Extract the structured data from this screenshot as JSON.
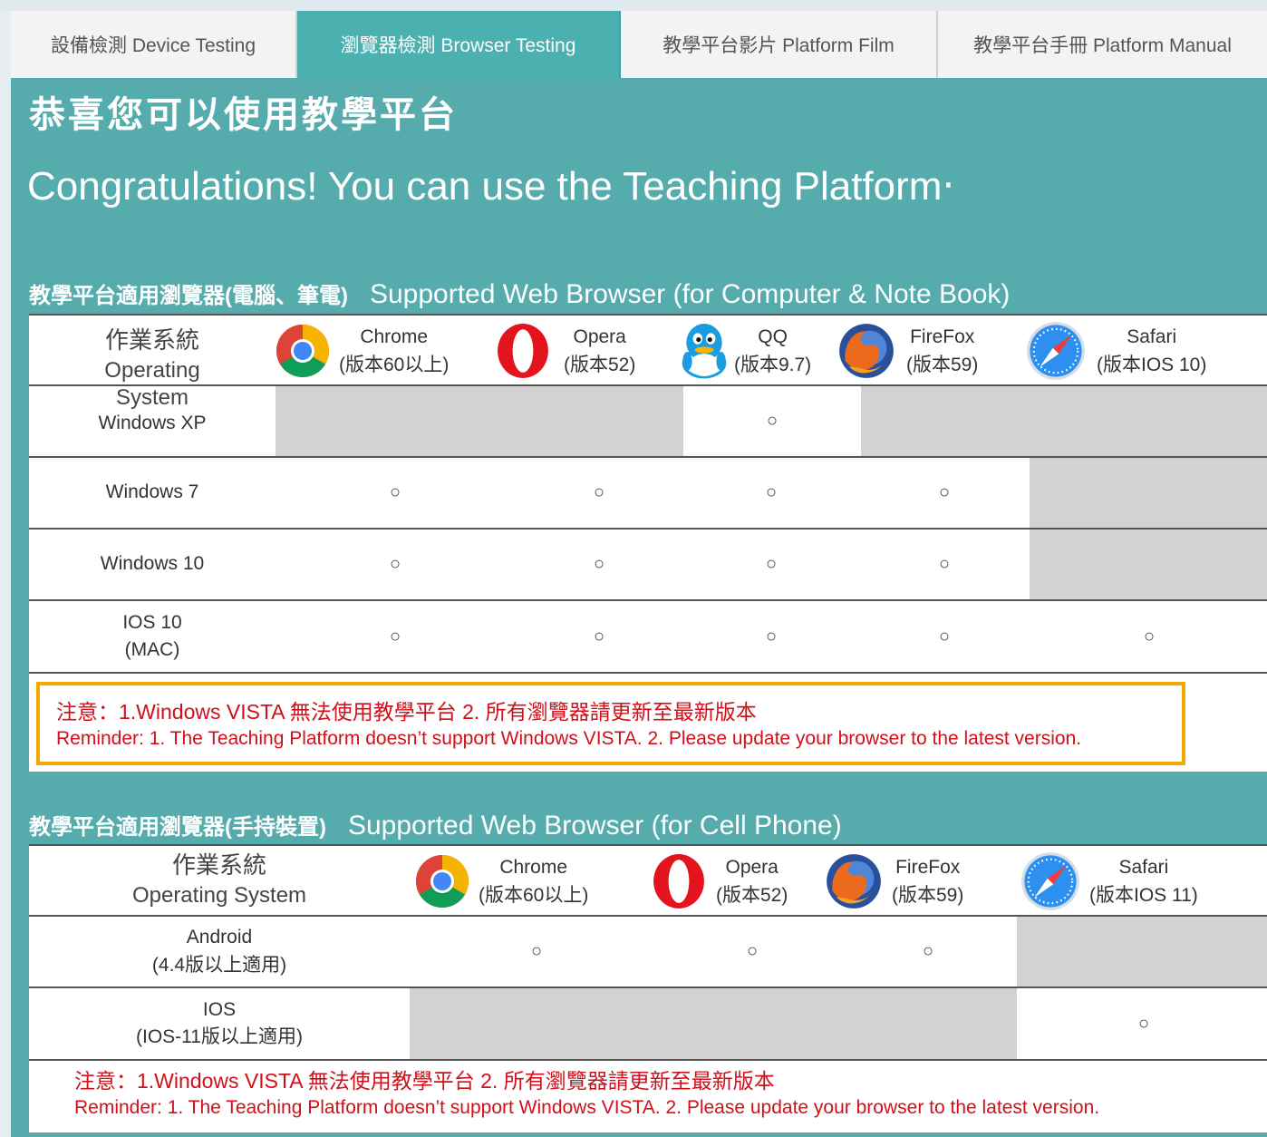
{
  "tabs": [
    {
      "label": "設備檢測 Device Testing",
      "active": false
    },
    {
      "label": "瀏覽器檢測 Browser Testing",
      "active": true
    },
    {
      "label": "教學平台影片 Platform Film",
      "active": false
    },
    {
      "label": "教學平台手冊 Platform Manual",
      "active": false
    }
  ],
  "header": {
    "title_zh": "恭喜您可以使用教學平台",
    "title_en": "Congratulations!  You can use the Teaching Platform‧"
  },
  "computer": {
    "label_zh": "教學平台適用瀏覽器(電腦、筆電)",
    "label_en": "Supported Web Browser (for Computer & Note Book)",
    "os_header_zh": "作業系統",
    "os_header_en": "Operating System",
    "browsers": [
      {
        "name": "Chrome",
        "version": "(版本60以上)",
        "icon": "chrome-icon"
      },
      {
        "name": "Opera",
        "version": "(版本52)",
        "icon": "opera-icon"
      },
      {
        "name": "QQ",
        "version": "(版本9.7)",
        "icon": "qq-icon"
      },
      {
        "name": "FireFox",
        "version": "(版本59)",
        "icon": "firefox-icon"
      },
      {
        "name": "Safari",
        "version": "(版本IOS 10)",
        "icon": "safari-icon"
      }
    ],
    "rows": [
      {
        "os": "Windows XP",
        "os2": "",
        "support": [
          false,
          false,
          true,
          false,
          false
        ]
      },
      {
        "os": "Windows 7",
        "os2": "",
        "support": [
          true,
          true,
          true,
          true,
          false
        ]
      },
      {
        "os": "Windows 10",
        "os2": "",
        "support": [
          true,
          true,
          true,
          true,
          false
        ]
      },
      {
        "os": "IOS 10",
        "os2": "(MAC)",
        "support": [
          true,
          true,
          true,
          true,
          true
        ]
      }
    ],
    "mark": "○",
    "notice_zh": "注意：1.Windows VISTA 無法使用教學平台  2. 所有瀏覽器請更新至最新版本",
    "notice_en": "Reminder: 1. The Teaching Platform doesn’t support Windows VISTA.  2. Please update your browser to the latest version."
  },
  "phone": {
    "label_zh": "教學平台適用瀏覽器(手持裝置)",
    "label_en": "Supported Web Browser (for Cell Phone)",
    "os_header_zh": "作業系統",
    "os_header_en": "Operating System",
    "browsers": [
      {
        "name": "Chrome",
        "version": "(版本60以上)",
        "icon": "chrome-icon"
      },
      {
        "name": "Opera",
        "version": "(版本52)",
        "icon": "opera-icon"
      },
      {
        "name": "FireFox",
        "version": "(版本59)",
        "icon": "firefox-icon"
      },
      {
        "name": "Safari",
        "version": "(版本IOS 11)",
        "icon": "safari-icon"
      }
    ],
    "rows": [
      {
        "os": "Android",
        "os2": "(4.4版以上適用)",
        "support": [
          true,
          true,
          true,
          false
        ]
      },
      {
        "os": "IOS",
        "os2": "(IOS-11版以上適用)",
        "support": [
          false,
          false,
          false,
          true
        ]
      }
    ],
    "mark": "○",
    "notice_zh": "注意：1.Windows VISTA 無法使用教學平台  2. 所有瀏覽器請更新至最新版本",
    "notice_en": "Reminder: 1. The Teaching Platform doesn’t support Windows VISTA.  2. Please update your browser to the latest version."
  },
  "colors": {
    "panel": "#56acad",
    "tab_active": "#4ab0b0",
    "notice_text": "#d0101a",
    "notice_border": "#f5a800",
    "unsupported_cell": "#d2d2d2"
  }
}
